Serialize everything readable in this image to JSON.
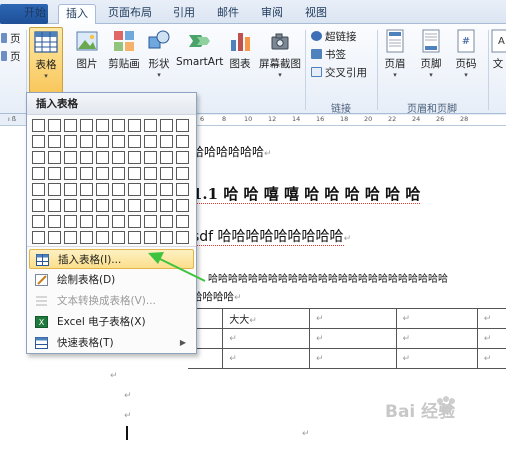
{
  "tabs": [
    {
      "label": "开始"
    },
    {
      "label": "插入"
    },
    {
      "label": "页面布局"
    },
    {
      "label": "引用"
    },
    {
      "label": "邮件"
    },
    {
      "label": "审阅"
    },
    {
      "label": "视图"
    }
  ],
  "ribbon": {
    "left_partial": [
      "页",
      "页"
    ],
    "buttons": {
      "table": "表格",
      "picture": "图片",
      "clipart": "剪贴画",
      "shapes": "形状",
      "smartart": "SmartArt",
      "chart": "图表",
      "screenshot": "屏幕截图",
      "header": "页眉",
      "footer": "页脚",
      "pagenum": "页码",
      "text_partial": "文"
    },
    "links_group": {
      "hyperlink": "超链接",
      "bookmark": "书签",
      "crossref": "交叉引用",
      "label": "链接"
    },
    "header_footer_group_label": "页眉和页脚"
  },
  "ruler": [
    "6",
    "8",
    "10",
    "12",
    "14",
    "16",
    "18",
    "20",
    "22",
    "24",
    "26",
    "28"
  ],
  "dropdown": {
    "title": "插入表格",
    "items": [
      {
        "label": "插入表格(I)...",
        "highlighted": true,
        "enabled": true
      },
      {
        "label": "绘制表格(D)",
        "enabled": true
      },
      {
        "label": "文本转换成表格(V)...",
        "enabled": false
      },
      {
        "label": "Excel 电子表格(X)",
        "enabled": true
      },
      {
        "label": "快速表格(T)",
        "enabled": true,
        "submenu": true
      }
    ]
  },
  "document": {
    "line1": "哈哈哈哈哈哈",
    "heading": "1.1  哈 哈 嘻 嘻 哈 哈 哈 哈 哈 哈",
    "line3": "sdf 哈哈哈哈哈哈哈哈哈",
    "line4": "哈哈哈哈哈哈哈哈哈哈哈哈哈哈哈哈哈哈哈哈哈哈哈哈",
    "line5": "哈哈哈哈",
    "table_cell": "大大",
    "para_mark": "↵"
  },
  "watermark": "Bai 经验"
}
